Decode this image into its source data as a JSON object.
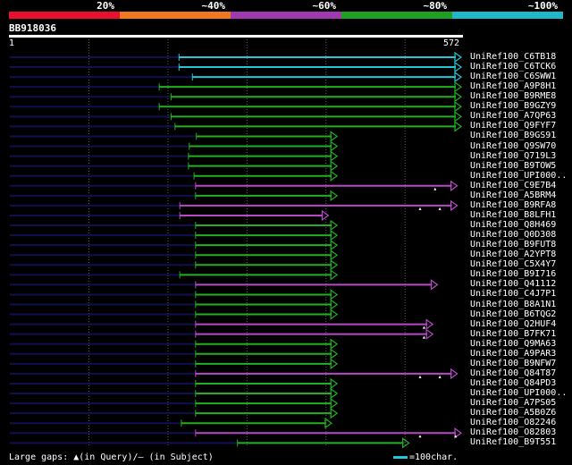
{
  "scale_bar": {
    "segments": [
      {
        "label": "20%",
        "color": "#e8102c"
      },
      {
        "label": "~40%",
        "color": "#f07820"
      },
      {
        "label": "~60%",
        "color": "#a038b0"
      },
      {
        "label": "~80%",
        "color": "#20a020"
      },
      {
        "label": "~100%",
        "color": "#20b8c8"
      }
    ]
  },
  "query": {
    "name": "BB918036",
    "start": "1",
    "end": "572",
    "length": 572
  },
  "colors": {
    "cyan": "#20c8d8",
    "green": "#20b020",
    "magenta": "#b848c8",
    "unaligned": "#101050",
    "gridline": "#606060",
    "gap_marker": "#ffffff"
  },
  "hits": [
    {
      "id": "UniRef100_C6TB18",
      "color": "cyan",
      "start": 215,
      "end": 572,
      "qgaps": []
    },
    {
      "id": "UniRef100_C6TCK6",
      "color": "cyan",
      "start": 215,
      "end": 572,
      "qgaps": []
    },
    {
      "id": "UniRef100_C6SWW1",
      "color": "cyan",
      "start": 232,
      "end": 572,
      "qgaps": []
    },
    {
      "id": "UniRef100_A9P8H1",
      "color": "green",
      "start": 190,
      "end": 572,
      "qgaps": []
    },
    {
      "id": "UniRef100_B9RME8",
      "color": "green",
      "start": 205,
      "end": 572,
      "qgaps": []
    },
    {
      "id": "UniRef100_B9GZY9",
      "color": "green",
      "start": 190,
      "end": 572,
      "qgaps": []
    },
    {
      "id": "UniRef100_A7QP63",
      "color": "green",
      "start": 205,
      "end": 572,
      "qgaps": []
    },
    {
      "id": "UniRef100_Q9FYF7",
      "color": "green",
      "start": 210,
      "end": 572,
      "qgaps": []
    },
    {
      "id": "UniRef100_B9GS91",
      "color": "green",
      "start": 237,
      "end": 415,
      "qgaps": []
    },
    {
      "id": "UniRef100_Q9SW70",
      "color": "green",
      "start": 228,
      "end": 415,
      "qgaps": []
    },
    {
      "id": "UniRef100_Q719L3",
      "color": "green",
      "start": 227,
      "end": 415,
      "qgaps": []
    },
    {
      "id": "UniRef100_B9TOW5",
      "color": "green",
      "start": 227,
      "end": 415,
      "qgaps": []
    },
    {
      "id": "UniRef100_UPI000..",
      "color": "green",
      "start": 234,
      "end": 415,
      "qgaps": []
    },
    {
      "id": "UniRef100_C9E7B4",
      "color": "magenta",
      "start": 236,
      "end": 567,
      "qgaps": [
        539
      ]
    },
    {
      "id": "UniRef100_A5BRM4",
      "color": "green",
      "start": 236,
      "end": 415,
      "qgaps": []
    },
    {
      "id": "UniRef100_B9RFA8",
      "color": "magenta",
      "start": 216,
      "end": 567,
      "qgaps": [
        520,
        545
      ]
    },
    {
      "id": "UniRef100_B8LFH1",
      "color": "magenta",
      "start": 216,
      "end": 404,
      "qgaps": []
    },
    {
      "id": "UniRef100_Q8H469",
      "color": "green",
      "start": 236,
      "end": 415,
      "qgaps": []
    },
    {
      "id": "UniRef100_Q0D308",
      "color": "green",
      "start": 236,
      "end": 415,
      "qgaps": []
    },
    {
      "id": "UniRef100_B9FUT8",
      "color": "green",
      "start": 236,
      "end": 415,
      "qgaps": []
    },
    {
      "id": "UniRef100_A2YPT8",
      "color": "green",
      "start": 236,
      "end": 415,
      "qgaps": []
    },
    {
      "id": "UniRef100_C5X4Y7",
      "color": "green",
      "start": 236,
      "end": 415,
      "qgaps": []
    },
    {
      "id": "UniRef100_B9I716",
      "color": "green",
      "start": 216,
      "end": 415,
      "qgaps": []
    },
    {
      "id": "UniRef100_Q41112",
      "color": "magenta",
      "start": 236,
      "end": 542,
      "qgaps": []
    },
    {
      "id": "UniRef100_C4J7P1",
      "color": "green",
      "start": 236,
      "end": 415,
      "qgaps": []
    },
    {
      "id": "UniRef100_B8A1N1",
      "color": "green",
      "start": 236,
      "end": 415,
      "qgaps": []
    },
    {
      "id": "UniRef100_B6TQG2",
      "color": "green",
      "start": 236,
      "end": 415,
      "qgaps": []
    },
    {
      "id": "UniRef100_Q2HUF4",
      "color": "magenta",
      "start": 236,
      "end": 536,
      "qgaps": [
        525
      ]
    },
    {
      "id": "UniRef100_B7FK71",
      "color": "magenta",
      "start": 236,
      "end": 536,
      "qgaps": [
        525
      ]
    },
    {
      "id": "UniRef100_Q9MA63",
      "color": "green",
      "start": 236,
      "end": 415,
      "qgaps": []
    },
    {
      "id": "UniRef100_A9PAR3",
      "color": "green",
      "start": 236,
      "end": 415,
      "qgaps": []
    },
    {
      "id": "UniRef100_B9NFW7",
      "color": "green",
      "start": 236,
      "end": 415,
      "qgaps": []
    },
    {
      "id": "UniRef100_Q84T87",
      "color": "magenta",
      "start": 236,
      "end": 567,
      "qgaps": [
        520,
        545
      ]
    },
    {
      "id": "UniRef100_Q84PD3",
      "color": "green",
      "start": 236,
      "end": 415,
      "qgaps": []
    },
    {
      "id": "UniRef100_UPI000..",
      "color": "green",
      "start": 236,
      "end": 415,
      "qgaps": []
    },
    {
      "id": "UniRef100_A7PS05",
      "color": "green",
      "start": 236,
      "end": 415,
      "qgaps": []
    },
    {
      "id": "UniRef100_A5B0Z6",
      "color": "green",
      "start": 236,
      "end": 415,
      "qgaps": []
    },
    {
      "id": "UniRef100_O82246",
      "color": "green",
      "start": 218,
      "end": 408,
      "qgaps": []
    },
    {
      "id": "UniRef100_O82803",
      "color": "magenta",
      "start": 236,
      "end": 572,
      "qgaps": [
        520,
        565
      ]
    },
    {
      "id": "UniRef100_B9T551",
      "color": "green",
      "start": 289,
      "end": 506,
      "qgaps": []
    }
  ],
  "footer": {
    "gaps_legend": "Large gaps: ▲(in Query)/– (in Subject)",
    "scale_label": "=100char."
  }
}
